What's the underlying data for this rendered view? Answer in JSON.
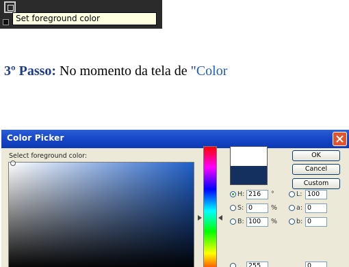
{
  "tooltip": {
    "text": "Set foreground color"
  },
  "step": {
    "label": "3º Passo:",
    "text": " No momento da tela de ",
    "q_open": "\"",
    "link": "Color"
  },
  "dialog": {
    "title": "Color Picker",
    "select_label": "Select foreground color:",
    "buttons": {
      "ok": "OK",
      "cancel": "Cancel",
      "custom": "Custom"
    },
    "hsb": {
      "h": {
        "label": "H:",
        "value": "216",
        "unit": "°"
      },
      "s": {
        "label": "S:",
        "value": "0",
        "unit": "%"
      },
      "b": {
        "label": "B:",
        "value": "100",
        "unit": "%"
      }
    },
    "lab": {
      "l": {
        "label": "L:",
        "value": "100"
      },
      "a": {
        "label": "a:",
        "value": "0"
      },
      "b": {
        "label": "b:",
        "value": "0"
      }
    },
    "partial_row": {
      "left_value": "255",
      "right_value": "0"
    },
    "colors": {
      "new": "#ffffff",
      "current": "#13305f",
      "title_bar": "#1848c8",
      "close": "#e2532f"
    }
  }
}
